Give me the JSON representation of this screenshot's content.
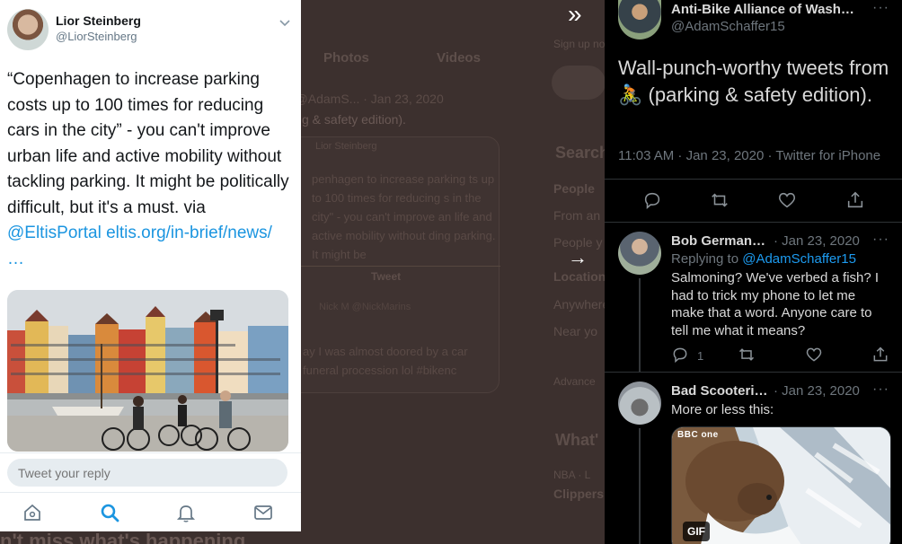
{
  "background": {
    "tabs": [
      "Photos",
      "Videos"
    ],
    "tweet_head": ") @AdamS... · Jan 23, 2020",
    "tweet_text": "g & safety edition).",
    "quote_author": "Lior Steinberg",
    "quote_text": "penhagen to increase parking ts up to 100 times for reducing s in the city\" - you can't improve an life and active mobility without ding parking. It might be",
    "quote_label": "Tweet",
    "quote_nick": "Nick M @NickMarins",
    "quote_foot": "ay I was almost doored by a car funeral procession lol #bikenc",
    "side_search_hint": "Sign up no",
    "side_search": "Search",
    "side_people": "People",
    "side_from": "From an",
    "side_people2": "People y",
    "side_location": "Location",
    "side_anywhere": "Anywhere",
    "side_near": "Near yo",
    "side_advanced": "Advance",
    "side_whats": "What'",
    "side_nba": "NBA · L",
    "side_clippers": "Clippers",
    "bottom_text": "n't miss what's happening"
  },
  "phone": {
    "author_name": "Lior Steinberg",
    "author_handle": "@LiorSteinberg",
    "tweet_text": "“Copenhagen to increase parking costs up to 100 times for reducing cars in the city” - you can't improve urban life and active mobility without tackling parking. It might be politically difficult, but it's a must. via ",
    "mention": "@EltisPortal",
    "link": "eltis.org/in-brief/news/",
    "ellipsis": "…",
    "reply_placeholder": "Tweet your reply",
    "tabs": [
      "home-icon",
      "search-icon",
      "notifications-icon",
      "messages-icon"
    ]
  },
  "thread": {
    "main": {
      "name": "Anti-Bike Alliance of Wash…",
      "handle": "@AdamSchaffer15",
      "text_before": "Wall-punch-worthy tweets from ",
      "emoji": "🚴",
      "text_after": " (parking & safety edition).",
      "time": "11:03 AM · Jan 23, 2020 · Twitter for iPhone"
    },
    "reply1": {
      "name": "Bob German…",
      "date": "· Jan 23, 2020",
      "replying_to_prefix": "Replying to ",
      "replying_to": "@AdamSchaffer15",
      "text": "Salmoning? We've verbed a fish? I had to trick my phone to let me make that a word. Anyone care to tell me what it means?",
      "reply_count": "1"
    },
    "reply2": {
      "name": "Bad Scooteri…",
      "date": "· Jan 23, 2020",
      "text": "More or less this:",
      "media_watermark": "BBC one",
      "gif_label": "GIF"
    },
    "more": "···"
  },
  "colors": {
    "link_blue": "#1b95e0",
    "dark_bg": "#000000",
    "dim_overlay": "#3c302e"
  }
}
